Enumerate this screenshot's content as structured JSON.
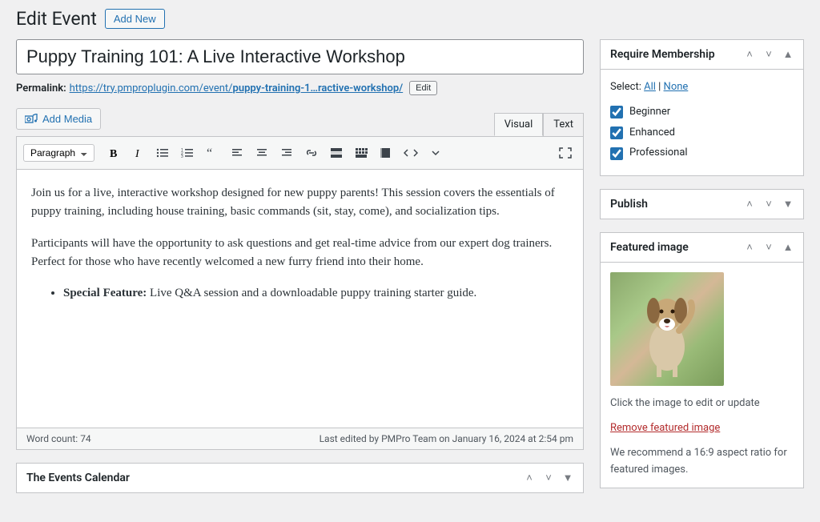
{
  "header": {
    "page_title": "Edit Event",
    "add_new_label": "Add New"
  },
  "title_input_value": "Puppy Training 101: A Live Interactive Workshop",
  "permalink": {
    "label": "Permalink:",
    "base": "https://try.pmproplugin.com/event/",
    "slug": "puppy-training-1…ractive-workshop/",
    "edit_label": "Edit"
  },
  "editor": {
    "add_media_label": "Add Media",
    "tab_visual": "Visual",
    "tab_text": "Text",
    "format_select": "Paragraph",
    "content": {
      "p1": "Join us for a live, interactive workshop designed for new puppy parents! This session covers the essentials of puppy training, including house training, basic commands (sit, stay, come), and socialization tips.",
      "p2": "Participants will have the opportunity to ask questions and get real-time advice from our expert dog trainers. Perfect for those who have recently welcomed a new furry friend into their home.",
      "li1_strong": "Special Feature:",
      "li1_rest": " Live Q&A session and a downloadable puppy training starter guide."
    },
    "word_count_label": "Word count: ",
    "word_count": "74",
    "last_edited": "Last edited by PMPro Team on January 16, 2024 at 2:54 pm"
  },
  "events_calendar": {
    "title": "The Events Calendar"
  },
  "membership": {
    "title": "Require Membership",
    "select_label": "Select:",
    "all": "All",
    "sep": " | ",
    "none": "None",
    "levels": [
      {
        "label": "Beginner",
        "checked": true
      },
      {
        "label": "Enhanced",
        "checked": true
      },
      {
        "label": "Professional",
        "checked": true
      }
    ]
  },
  "publish": {
    "title": "Publish"
  },
  "featured": {
    "title": "Featured image",
    "caption1": "Click the image to edit or update",
    "remove_label": "Remove featured image",
    "caption2": "We recommend a 16:9 aspect ratio for featured images."
  }
}
